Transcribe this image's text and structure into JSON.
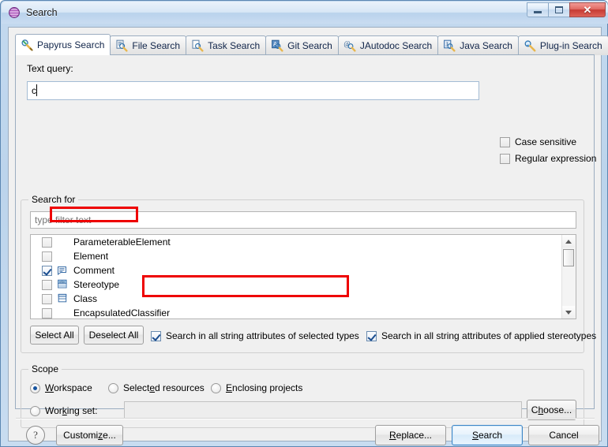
{
  "window": {
    "title": "Search",
    "icon": "search-sphere-icon",
    "buttons": {
      "minimize": "minimize-icon",
      "maximize": "maximize-icon",
      "close": "close-icon",
      "close_glyph": "✕"
    }
  },
  "tabs": [
    {
      "label": "Papyrus Search",
      "icon": "papyrus-search-icon",
      "active": true
    },
    {
      "label": "File Search",
      "icon": "file-search-icon",
      "active": false
    },
    {
      "label": "Task Search",
      "icon": "task-search-icon",
      "active": false
    },
    {
      "label": "Git Search",
      "icon": "git-search-icon",
      "active": false
    },
    {
      "label": "JAutodoc Search",
      "icon": "jautodoc-search-icon",
      "active": false
    },
    {
      "label": "Java Search",
      "icon": "java-search-icon",
      "active": false
    },
    {
      "label": "Plug-in Search",
      "icon": "plugin-search-icon",
      "active": false
    }
  ],
  "text_query": {
    "label": "Text query:",
    "value": "c",
    "placeholder": ""
  },
  "query_options": [
    {
      "label": "Case sensitive",
      "checked": false
    },
    {
      "label": "Regular expression",
      "checked": false
    }
  ],
  "search_for": {
    "group_title": "Search for",
    "filter_placeholder": "type filter text",
    "filter_value": "",
    "items": [
      {
        "label": "ParameterableElement",
        "checked": false,
        "icon": ""
      },
      {
        "label": "Element",
        "checked": false,
        "icon": ""
      },
      {
        "label": "Comment",
        "checked": true,
        "icon": "comment-icon"
      },
      {
        "label": "Stereotype",
        "checked": false,
        "icon": "stereotype-icon"
      },
      {
        "label": "Class",
        "checked": false,
        "icon": "class-icon"
      },
      {
        "label": "EncapsulatedClassifier",
        "checked": false,
        "icon": ""
      }
    ],
    "select_all_label": "Select All",
    "deselect_all_label": "Deselect All",
    "options": [
      {
        "label": "Search in all string attributes of selected types",
        "checked": true
      },
      {
        "label": "Search in all string attributes of applied stereotypes",
        "checked": true
      }
    ]
  },
  "scope": {
    "group_title": "Scope",
    "radios": [
      {
        "label": "Workspace",
        "mnemonic": "W",
        "selected": true
      },
      {
        "label": "Selected resources",
        "mnemonic": "e",
        "selected": false
      },
      {
        "label": "Enclosing projects",
        "mnemonic": "E",
        "selected": false
      },
      {
        "label": "Working set:",
        "mnemonic": "k",
        "selected": false
      }
    ],
    "working_set_value": "",
    "choose_label": "Choose...",
    "choose_mnemonic": "h"
  },
  "footer": {
    "help_label": "?",
    "customize_label": "Customize...",
    "customize_mnemonic": "z",
    "replace_label": "Replace...",
    "replace_mnemonic": "R",
    "search_label": "Search",
    "search_mnemonic": "S",
    "cancel_label": "Cancel",
    "default_button": "Search"
  },
  "annotations": {
    "highlight_color": "#ee0000",
    "boxes": [
      {
        "name": "comment-row-highlight"
      },
      {
        "name": "selected-types-option-highlight"
      }
    ]
  }
}
